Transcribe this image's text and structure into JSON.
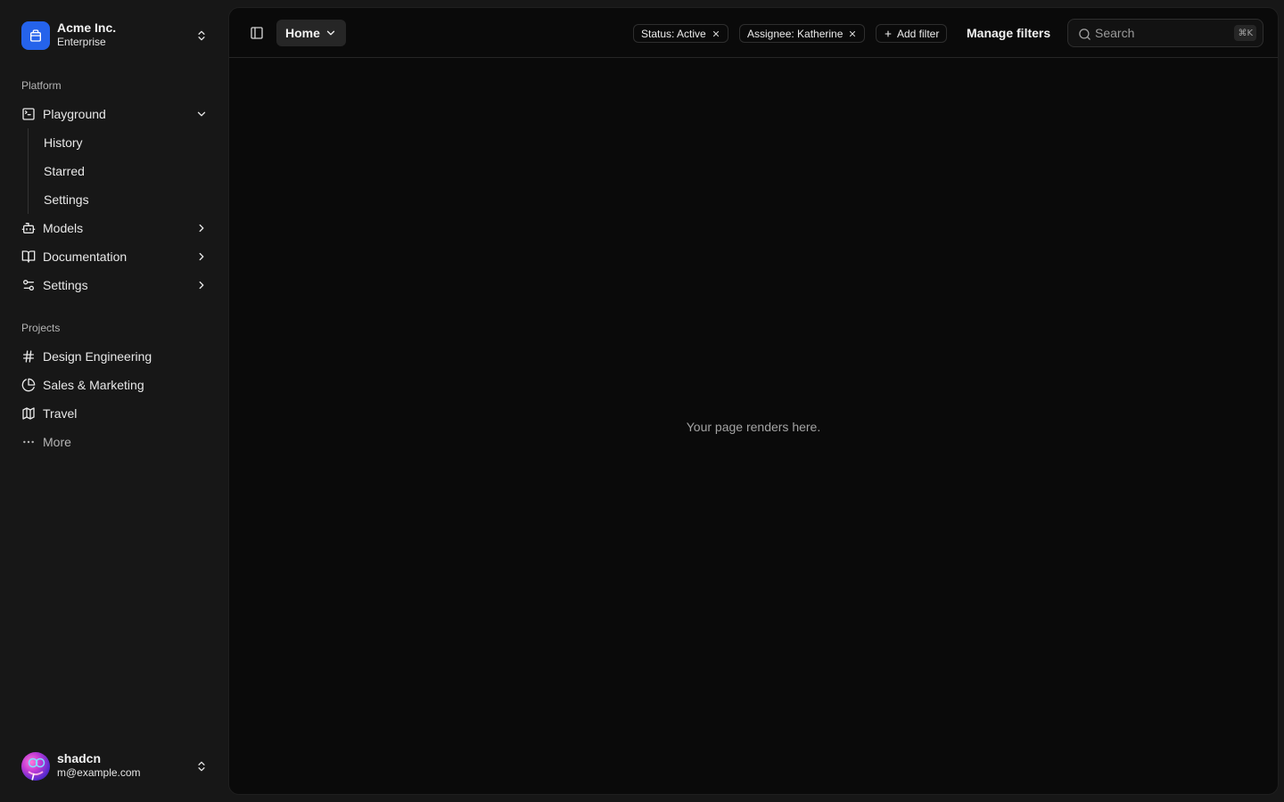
{
  "team": {
    "name": "Acme Inc.",
    "plan": "Enterprise"
  },
  "sidebar": {
    "platform_label": "Platform",
    "nav": [
      {
        "label": "Playground",
        "icon": "square-terminal-icon",
        "expanded": true,
        "children": [
          "History",
          "Starred",
          "Settings"
        ]
      },
      {
        "label": "Models",
        "icon": "bot-icon"
      },
      {
        "label": "Documentation",
        "icon": "book-open-icon"
      },
      {
        "label": "Settings",
        "icon": "settings-2-icon"
      }
    ],
    "projects_label": "Projects",
    "projects": [
      {
        "label": "Design Engineering",
        "icon": "hash-icon"
      },
      {
        "label": "Sales & Marketing",
        "icon": "pie-chart-icon"
      },
      {
        "label": "Travel",
        "icon": "map-icon"
      }
    ],
    "more_label": "More"
  },
  "user": {
    "name": "shadcn",
    "email": "m@example.com"
  },
  "header": {
    "home_label": "Home",
    "filters": [
      {
        "label": "Status: Active"
      },
      {
        "label": "Assignee: Katherine"
      }
    ],
    "add_filter_label": "Add filter",
    "manage_filters_label": "Manage filters",
    "search_placeholder": "Search",
    "search_shortcut": "⌘K"
  },
  "content": {
    "placeholder": "Your page renders here."
  },
  "colors": {
    "accent": "#2563eb",
    "sidebar_bg": "#171717",
    "main_bg": "#0a0a0a"
  }
}
